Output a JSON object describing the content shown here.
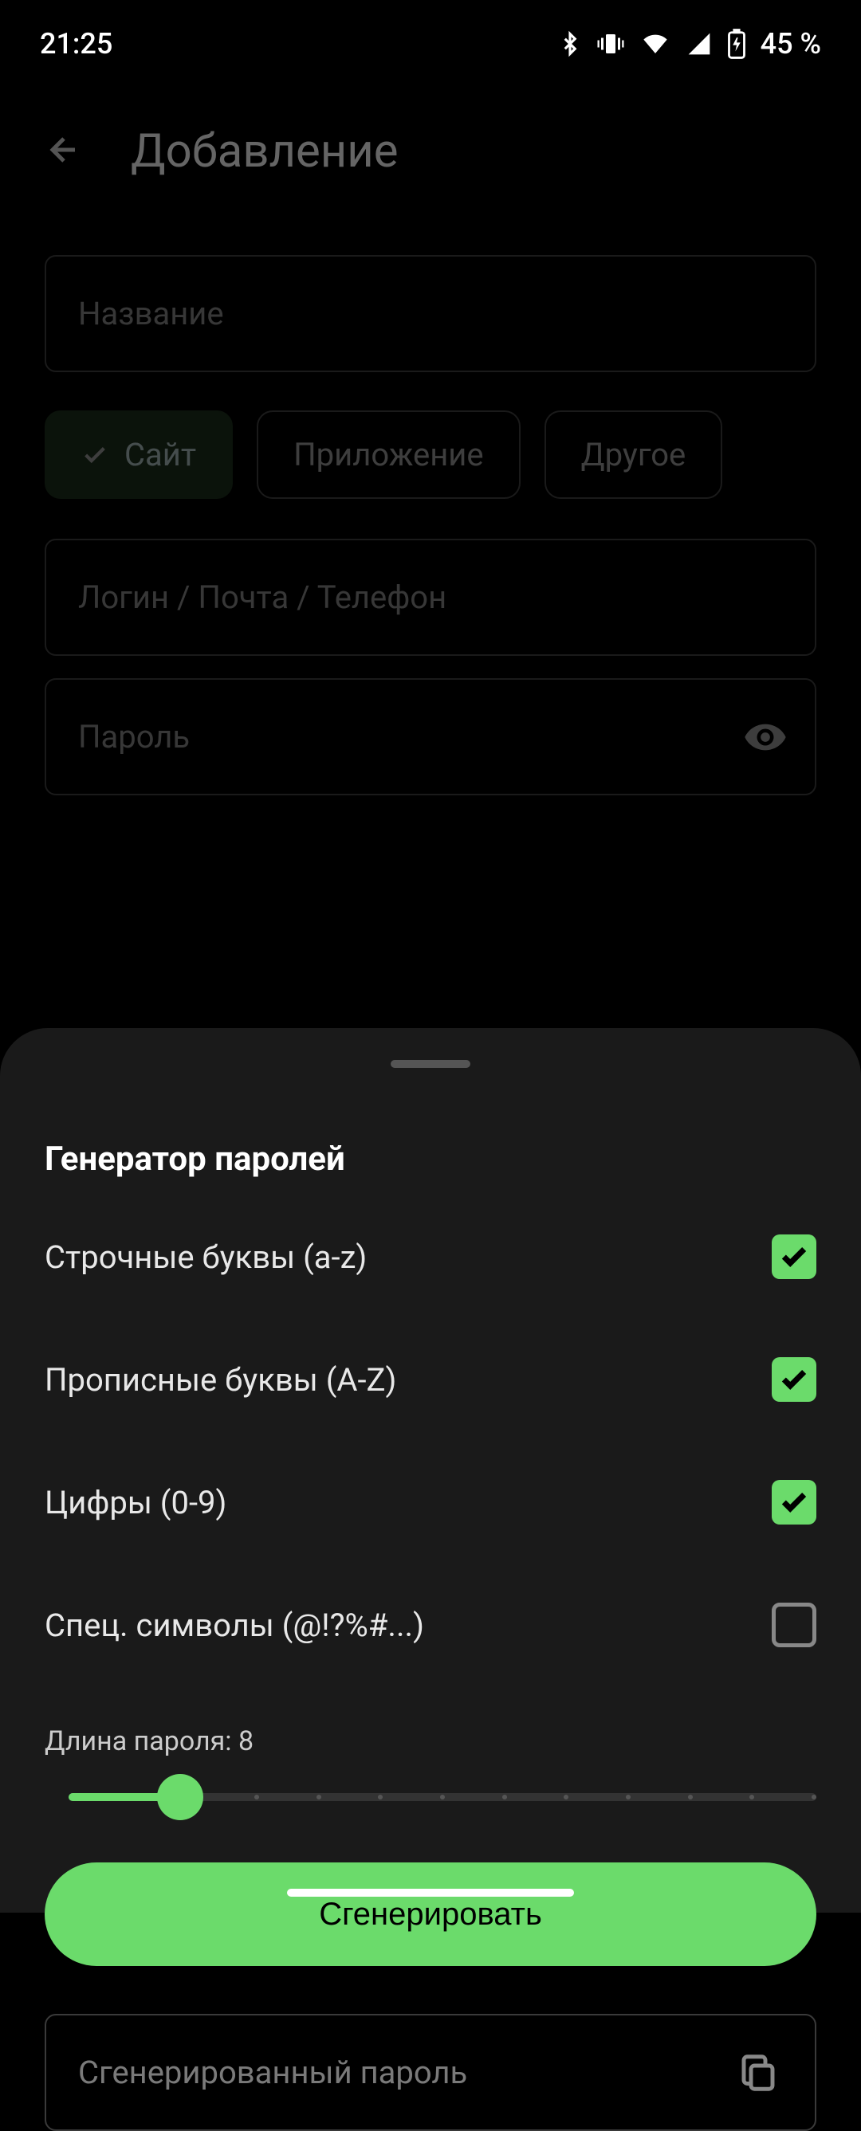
{
  "status": {
    "time": "21:25",
    "battery": "45 %"
  },
  "header": {
    "title": "Добавление"
  },
  "fields": {
    "name_placeholder": "Название",
    "login_placeholder": "Логин / Почта / Телефон",
    "password_placeholder": "Пароль"
  },
  "chips": [
    {
      "label": "Сайт",
      "selected": true
    },
    {
      "label": "Приложение",
      "selected": false
    },
    {
      "label": "Другое",
      "selected": false
    }
  ],
  "sheet": {
    "title": "Генератор паролей",
    "options": [
      {
        "label": "Строчные буквы (a-z)",
        "checked": true
      },
      {
        "label": "Прописные буквы (A-Z)",
        "checked": true
      },
      {
        "label": "Цифры (0-9)",
        "checked": true
      },
      {
        "label": "Спец. символы (@!?%#...)",
        "checked": false
      }
    ],
    "length_label": "Длина пароля: 8",
    "length_value": 8,
    "generate_label": "Сгенерировать",
    "result_placeholder": "Сгенерированный пароль"
  }
}
